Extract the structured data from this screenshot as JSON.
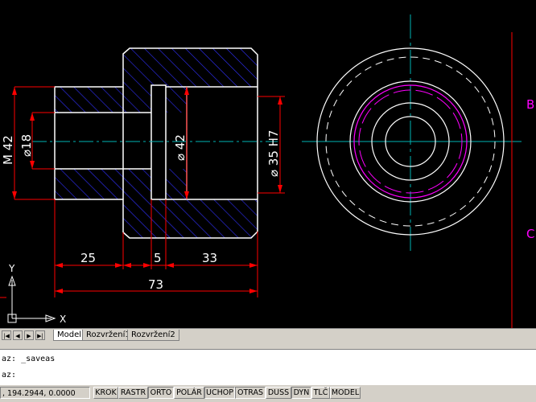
{
  "drawing": {
    "dims": {
      "m42": "M 42",
      "d18": "⌀18",
      "d42": "⌀ 42",
      "d35": "⌀ 35 H7",
      "l25": "25",
      "l5": "5",
      "l33": "33",
      "l73": "73"
    },
    "ucs": {
      "x": "X",
      "y": "Y"
    },
    "edge_labels": {
      "b": "B",
      "c": "C"
    }
  },
  "tabs": {
    "nav": [
      "|◀",
      "◀",
      "▶",
      "▶|"
    ],
    "items": [
      {
        "label": "Model",
        "active": true
      },
      {
        "label": "Rozvržení1",
        "active": false
      },
      {
        "label": "Rozvržení2",
        "active": false
      }
    ]
  },
  "command": {
    "line1": "az: _saveas",
    "line2": "az:"
  },
  "status": {
    "coords": ", 194.2944, 0.0000",
    "buttons": [
      {
        "label": "KROK",
        "on": false
      },
      {
        "label": "RASTR",
        "on": false
      },
      {
        "label": "ORTO",
        "on": true
      },
      {
        "label": "POLÁR",
        "on": false
      },
      {
        "label": "UCHOP",
        "on": true
      },
      {
        "label": "OTRAS",
        "on": true
      },
      {
        "label": "DUSS",
        "on": false
      },
      {
        "label": "DYN",
        "on": true
      },
      {
        "label": "TLČ",
        "on": false
      },
      {
        "label": "MODEL",
        "on": false
      }
    ]
  },
  "colors": {
    "background": "#000000",
    "outline": "#ffffff",
    "dimension": "#ff0000",
    "hatch": "#3030ff",
    "centerline": "#00b4b4",
    "thread": "#ff00ff"
  }
}
